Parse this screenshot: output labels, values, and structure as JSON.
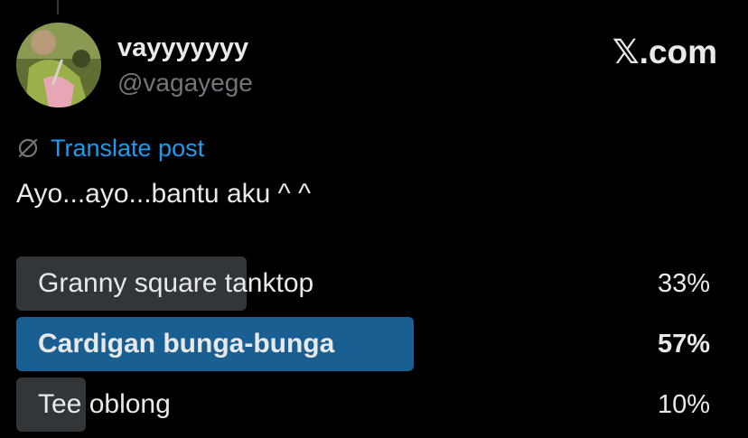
{
  "author": {
    "display_name": "vayyyyyyy",
    "handle": "@vagayege"
  },
  "brand": "𝕏.com",
  "translate_label": "Translate post",
  "post_text": "Ayo...ayo...bantu aku ^ ^",
  "icons": {
    "translate": "globe-slash-icon"
  },
  "colors": {
    "background": "#000000",
    "text": "#e7e9ea",
    "muted": "#71767b",
    "link": "#1d9bf0",
    "poll_bar": "#333639",
    "poll_winner_bar": "#1a5f92"
  },
  "poll": {
    "options": [
      {
        "label": "Granny square tanktop",
        "percent_text": "33%",
        "percent": 33,
        "winner": false
      },
      {
        "label": "Cardigan bunga-bunga",
        "percent_text": "57%",
        "percent": 57,
        "winner": true
      },
      {
        "label": "Tee oblong",
        "percent_text": "10%",
        "percent": 10,
        "winner": false
      }
    ]
  }
}
